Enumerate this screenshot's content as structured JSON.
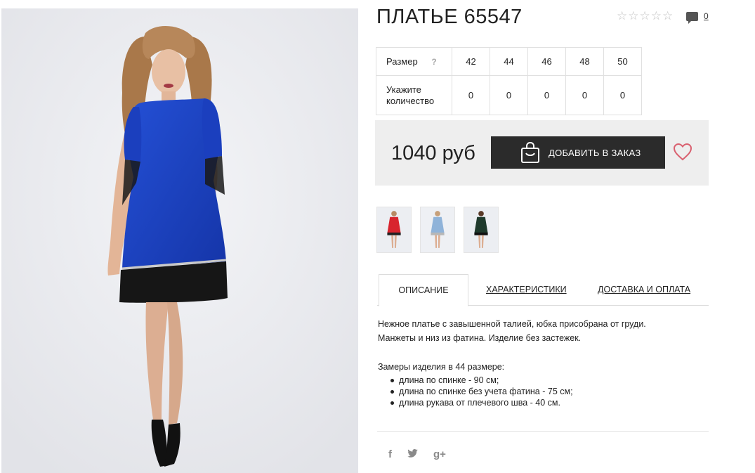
{
  "product": {
    "title": "ПЛАТЬЕ 65547",
    "rating_stars": 5,
    "rating_value": 0,
    "comments_count": "0"
  },
  "sizes": {
    "size_label": "Размер",
    "help_symbol": "?",
    "qty_label": "Укажите количество",
    "columns": [
      {
        "size": "42",
        "qty": "0"
      },
      {
        "size": "44",
        "qty": "0"
      },
      {
        "size": "46",
        "qty": "0"
      },
      {
        "size": "48",
        "qty": "0"
      },
      {
        "size": "50",
        "qty": "0"
      }
    ]
  },
  "buy": {
    "price": "1040 руб",
    "add_label": "ДОБАВИТЬ В ЗАКАЗ",
    "bag_icon": "shopping-bag-icon",
    "wishlist_icon": "heart-icon"
  },
  "color_variants": [
    {
      "name": "red",
      "dress_color": "#d8252e"
    },
    {
      "name": "light-blue",
      "dress_color": "#8fb3d9"
    },
    {
      "name": "dark-green",
      "dress_color": "#1f3a2c"
    }
  ],
  "tabs": [
    {
      "label": "ОПИСАНИЕ",
      "active": true
    },
    {
      "label": "ХАРАКТЕРИСТИКИ",
      "active": false
    },
    {
      "label": "ДОСТАВКА И ОПЛАТА",
      "active": false
    }
  ],
  "description": {
    "line1": "Нежное платье с завышенной талией, юбка присобрана от груди.",
    "line2": "Манжеты и низ из фатина. Изделие без застежек.",
    "measure_title": "Замеры изделия в 44 размере:",
    "measures": [
      "длина по спинке - 90 см;",
      "длина по спинке без учета фатина - 75 см;",
      "длина рукава от плечевого шва - 40 см."
    ]
  },
  "social": {
    "facebook": "f",
    "twitter": "🐦",
    "googleplus": "g+"
  },
  "colors": {
    "dress_main": "#1a3fc4",
    "button_bg": "#2b2b2b",
    "heart": "#d9606f",
    "buybox_bg": "#eeeeee"
  }
}
